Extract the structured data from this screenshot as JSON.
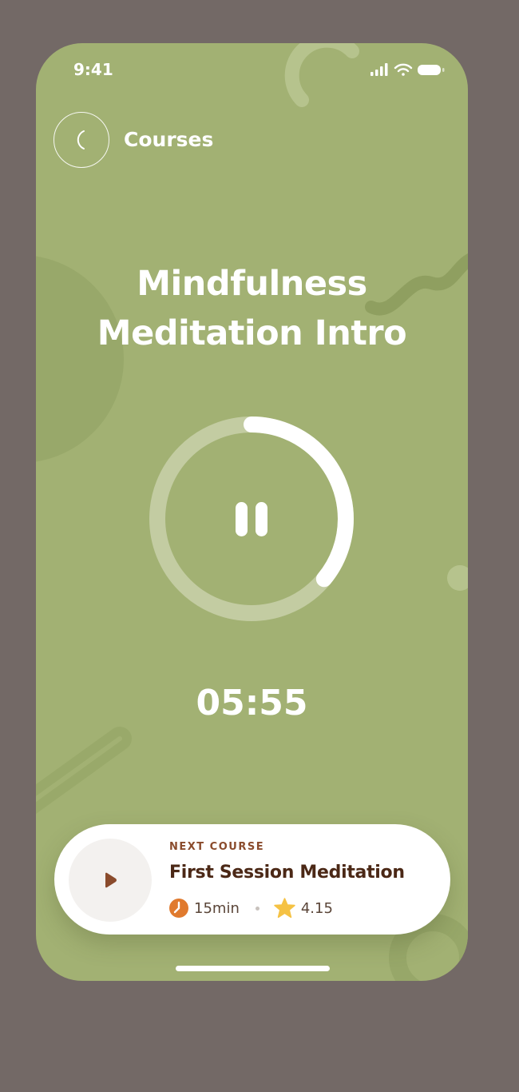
{
  "status_bar": {
    "time": "9:41"
  },
  "header": {
    "back_label": "Courses"
  },
  "player": {
    "title_line1": "Mindfulness",
    "title_line2": "Meditation Intro",
    "time_remaining": "05:55",
    "progress": 0.36
  },
  "next_course": {
    "kicker": "NEXT COURSE",
    "title": "First Session Meditation",
    "duration": "15min",
    "rating": "4.15"
  },
  "icons": {
    "back": "chevron-left-icon",
    "pause": "pause-icon",
    "play": "play-icon",
    "clock": "clock-icon",
    "star": "star-icon",
    "signal": "cellular-signal-icon",
    "wifi": "wifi-icon",
    "battery": "battery-icon"
  },
  "colors": {
    "background": "#736966",
    "screen": "#a2b173",
    "accent_brown": "#4b2816",
    "clock_orange": "#e07a2e",
    "star_yellow": "#f5c244"
  }
}
